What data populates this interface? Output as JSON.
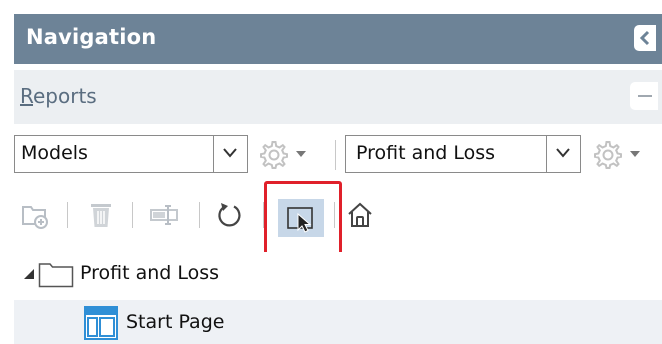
{
  "panel": {
    "title": "Navigation",
    "collapse_icon": "chevron-left-icon"
  },
  "section": {
    "title_accel": "R",
    "title_rest": "eports",
    "minimize_icon": "minus-icon"
  },
  "selectors": {
    "model": {
      "value": "Models"
    },
    "report": {
      "value": "Profit and Loss"
    }
  },
  "toolbar": {
    "icons": [
      "new-folder-icon",
      "delete-icon",
      "rename-icon",
      "refresh-icon",
      "select-icon",
      "home-icon"
    ],
    "active": "select-icon"
  },
  "tree": {
    "folder": {
      "label": "Profit and Loss",
      "expanded": true
    },
    "items": [
      {
        "label": "Start Page",
        "selected": true
      }
    ]
  },
  "colors": {
    "header_bg": "#6d8397",
    "section_bg": "#eceff2",
    "highlight": "#e0202a",
    "selected_tool": "#c7d7e8",
    "selected_row": "#eef1f5"
  }
}
